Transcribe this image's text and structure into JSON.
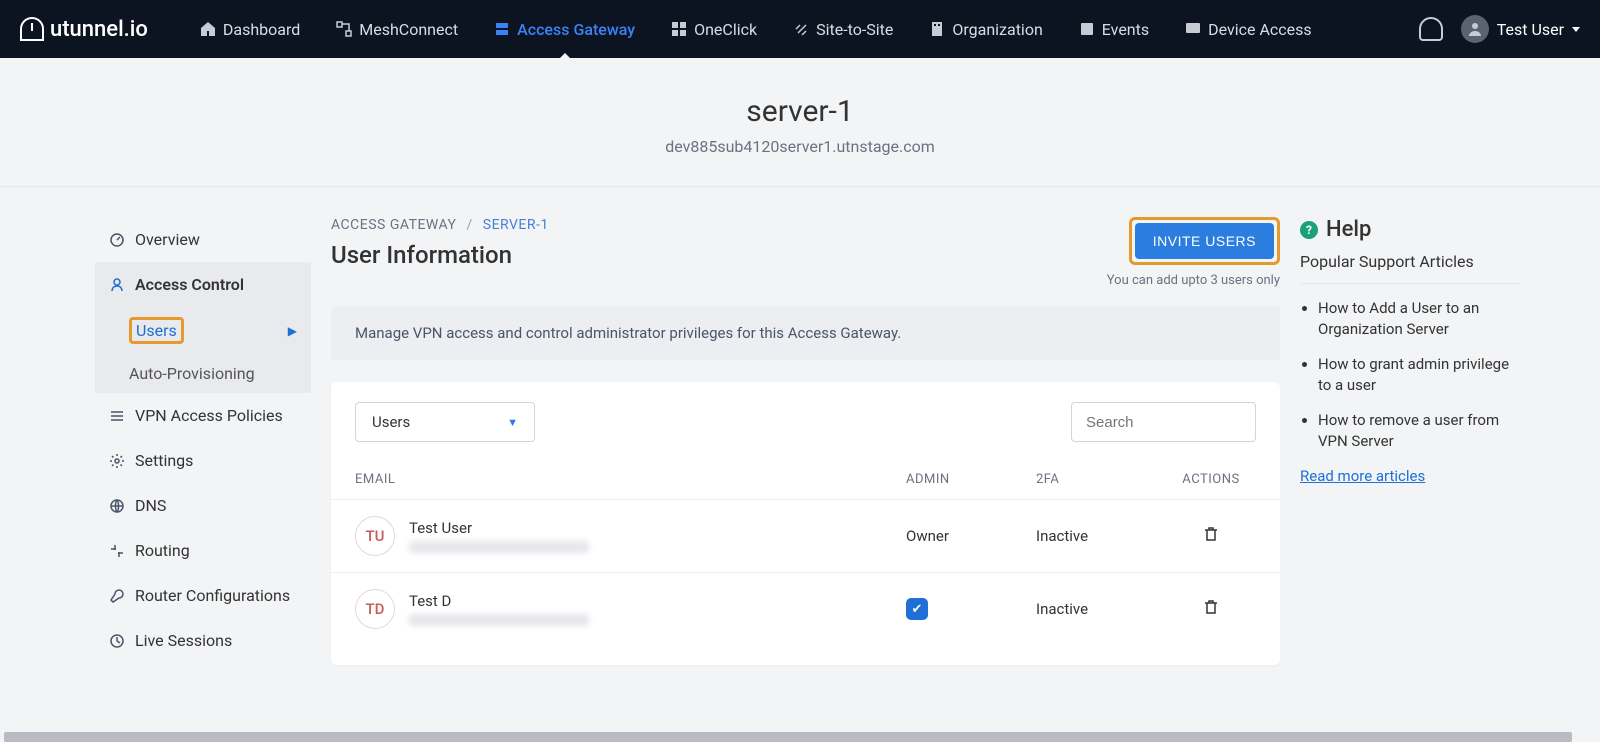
{
  "brand": "utunnel.io",
  "nav": {
    "dashboard": "Dashboard",
    "meshconnect": "MeshConnect",
    "access_gateway": "Access Gateway",
    "oneclick": "OneClick",
    "site_to_site": "Site-to-Site",
    "organization": "Organization",
    "events": "Events",
    "device_access": "Device Access"
  },
  "user_menu": {
    "name": "Test User"
  },
  "server": {
    "name": "server-1",
    "host": "dev885sub4120server1.utnstage.com"
  },
  "sidebar": {
    "overview": "Overview",
    "access_control": "Access Control",
    "users": "Users",
    "auto_provisioning": "Auto-Provisioning",
    "vpn_policies": "VPN Access Policies",
    "settings": "Settings",
    "dns": "DNS",
    "routing": "Routing",
    "router_configs": "Router Configurations",
    "live_sessions": "Live Sessions"
  },
  "breadcrumb": {
    "root": "ACCESS GATEWAY",
    "current": "SERVER-1"
  },
  "page": {
    "title": "User Information",
    "invite_btn": "INVITE USERS",
    "limit_text": "You can add upto 3 users only",
    "info_bar": "Manage VPN access and control administrator privileges for this Access Gateway."
  },
  "controls": {
    "dropdown_label": "Users",
    "search_placeholder": "Search"
  },
  "table": {
    "headers": {
      "email": "EMAIL",
      "admin": "ADMIN",
      "twofa": "2FA",
      "actions": "ACTIONS"
    },
    "rows": [
      {
        "initials": "TU",
        "name": "Test User",
        "admin": "Owner",
        "twofa": "Inactive"
      },
      {
        "initials": "TD",
        "name": "Test D",
        "admin_checked": true,
        "twofa": "Inactive"
      }
    ]
  },
  "help": {
    "title": "Help",
    "subtitle": "Popular Support Articles",
    "articles": [
      "How to Add a User to an Organization Server",
      "How to grant admin privilege to a user",
      "How to remove a user from VPN Server"
    ],
    "read_more": "Read more articles"
  }
}
